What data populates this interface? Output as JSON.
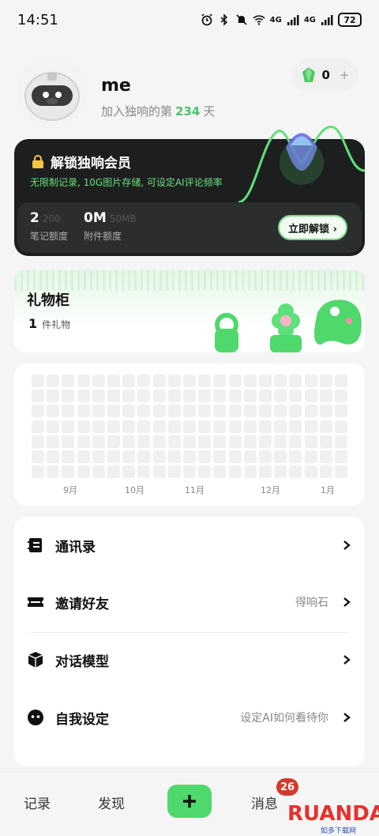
{
  "status_bar": {
    "time": "14:51",
    "battery": "72",
    "signal_1": "4G",
    "signal_2": "4G",
    "wifi_badge": "6"
  },
  "profile": {
    "username": "me",
    "join_prefix": "加入独响的第",
    "join_days": "234",
    "join_suffix": "天",
    "gems": "0",
    "gem_plus": "+"
  },
  "membership": {
    "title": "解锁独响会员",
    "subtitle": "无限制记录, 10G图片存储, 可设定AI评论频率",
    "notes_used": "2",
    "notes_max": "200",
    "notes_label": "笔记额度",
    "attach_used": "0M",
    "attach_max": "50MB",
    "attach_label": "附件额度",
    "unlock_label": "立即解锁 ›"
  },
  "gift": {
    "title": "礼物柜",
    "count": "1",
    "count_unit": "件礼物"
  },
  "heatmap": {
    "months": [
      "9月",
      "10月",
      "11月",
      "12月",
      "1月"
    ]
  },
  "menu": {
    "items": [
      {
        "label": "通讯录",
        "hint": "",
        "icon": "contacts-icon"
      },
      {
        "label": "邀请好友",
        "hint": "得响石",
        "icon": "ticket-icon"
      },
      {
        "label": "对话模型",
        "hint": "",
        "icon": "cube-icon"
      },
      {
        "label": "自我设定",
        "hint": "设定AI如何看待你",
        "icon": "face-icon"
      }
    ]
  },
  "nav": {
    "records": "记录",
    "discover": "发现",
    "messages": "消息",
    "badge": "26"
  },
  "watermark": {
    "brand": "RUANDAO",
    "sub": "如多下载网"
  },
  "colors": {
    "accent_green": "#4fd86b",
    "card_dark": "#1d1f1f",
    "badge_red": "#d33a2c"
  }
}
